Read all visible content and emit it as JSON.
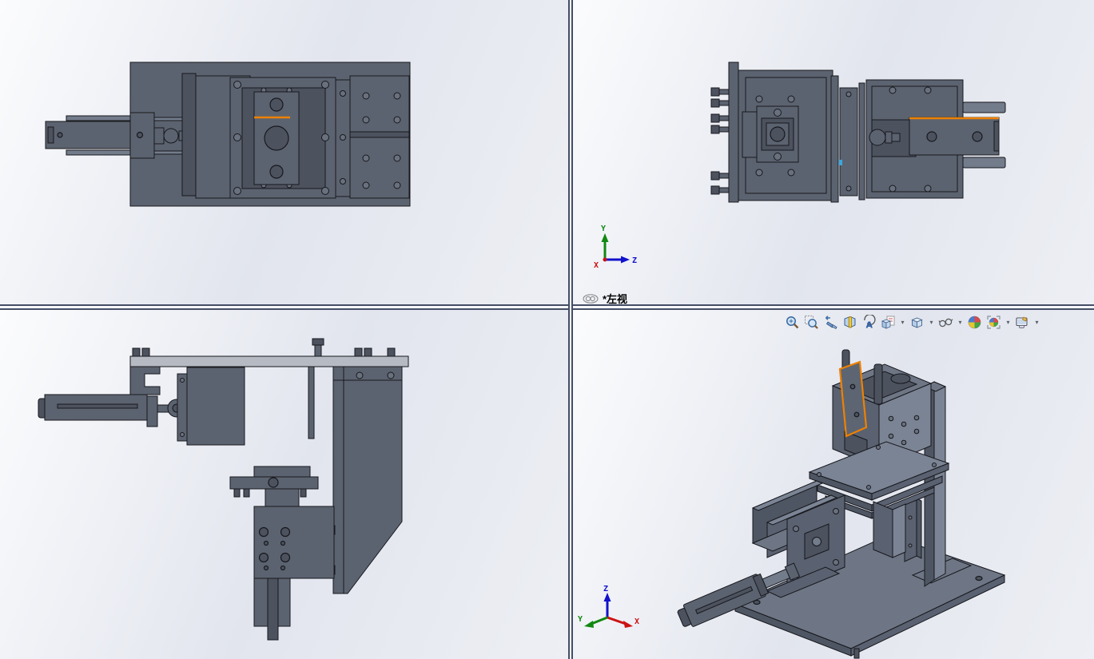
{
  "active_view_label": {
    "icon": "link-icon",
    "text": "*左视"
  },
  "toolbar": {
    "items": [
      {
        "name": "zoom-to-fit",
        "dropdown": false
      },
      {
        "name": "zoom-to-area",
        "dropdown": false
      },
      {
        "name": "previous-view",
        "dropdown": false
      },
      {
        "name": "section-view",
        "dropdown": false
      },
      {
        "name": "annotation-views",
        "dropdown": false
      },
      {
        "name": "view-orientation",
        "dropdown": true
      },
      {
        "name": "display-style",
        "dropdown": true
      },
      {
        "name": "hide-show-items",
        "dropdown": true
      },
      {
        "name": "edit-appearance",
        "dropdown": false
      },
      {
        "name": "apply-scene",
        "dropdown": true
      },
      {
        "name": "view-settings",
        "dropdown": true
      }
    ]
  },
  "triads": {
    "ortho": {
      "up": "Y",
      "right": "Z",
      "origin": "X"
    },
    "iso": {
      "up": "Z",
      "right": "X",
      "left": "Y"
    }
  },
  "colors": {
    "part": "#5c6370",
    "part-dark": "#4c525e",
    "part-light": "#737c8b",
    "part-lighter": "#9aa1ad",
    "edge": "#17181d",
    "highlight": "#ee8100",
    "axis-x": "#cc1111",
    "axis-y": "#118811",
    "axis-z": "#1111cc",
    "divider": "#454e66"
  }
}
